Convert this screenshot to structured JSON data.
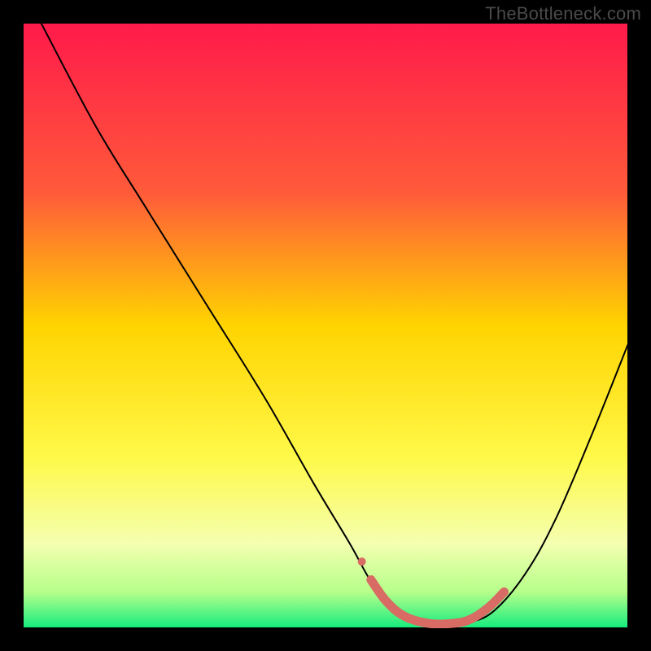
{
  "watermark": "TheBottleneck.com",
  "chart_data": {
    "type": "line",
    "title": "",
    "xlabel": "",
    "ylabel": "",
    "xlim": [
      0,
      100
    ],
    "ylim": [
      0,
      100
    ],
    "background_gradient": {
      "stops": [
        {
          "offset": 0,
          "color": "#ff1a4b"
        },
        {
          "offset": 28,
          "color": "#ff5a3a"
        },
        {
          "offset": 50,
          "color": "#ffd400"
        },
        {
          "offset": 72,
          "color": "#fff94a"
        },
        {
          "offset": 86,
          "color": "#f4ffb0"
        },
        {
          "offset": 94,
          "color": "#b6ff8a"
        },
        {
          "offset": 100,
          "color": "#13ec7e"
        }
      ]
    },
    "series": [
      {
        "name": "curve",
        "color": "#000000",
        "width": 2,
        "points": [
          {
            "x": 3,
            "y": 100
          },
          {
            "x": 12,
            "y": 83
          },
          {
            "x": 20,
            "y": 70
          },
          {
            "x": 30,
            "y": 54
          },
          {
            "x": 40,
            "y": 38
          },
          {
            "x": 48,
            "y": 24
          },
          {
            "x": 54,
            "y": 14
          },
          {
            "x": 58,
            "y": 7
          },
          {
            "x": 62,
            "y": 3
          },
          {
            "x": 66,
            "y": 1
          },
          {
            "x": 70,
            "y": 0.5
          },
          {
            "x": 74,
            "y": 1
          },
          {
            "x": 78,
            "y": 3
          },
          {
            "x": 83,
            "y": 9
          },
          {
            "x": 88,
            "y": 18
          },
          {
            "x": 94,
            "y": 32
          },
          {
            "x": 100,
            "y": 47
          }
        ]
      },
      {
        "name": "highlight",
        "color": "#d86b63",
        "width": 11,
        "linecap": "round",
        "points": [
          {
            "x": 57.5,
            "y": 8
          },
          {
            "x": 60,
            "y": 4.5
          },
          {
            "x": 63,
            "y": 2
          },
          {
            "x": 67,
            "y": 0.8
          },
          {
            "x": 71,
            "y": 0.8
          },
          {
            "x": 74,
            "y": 1.5
          },
          {
            "x": 77,
            "y": 3.5
          },
          {
            "x": 79.5,
            "y": 6
          }
        ]
      },
      {
        "name": "dot",
        "color": "#d86b63",
        "type_hint": "marker",
        "points": [
          {
            "x": 56,
            "y": 11,
            "r": 5
          }
        ]
      }
    ]
  }
}
